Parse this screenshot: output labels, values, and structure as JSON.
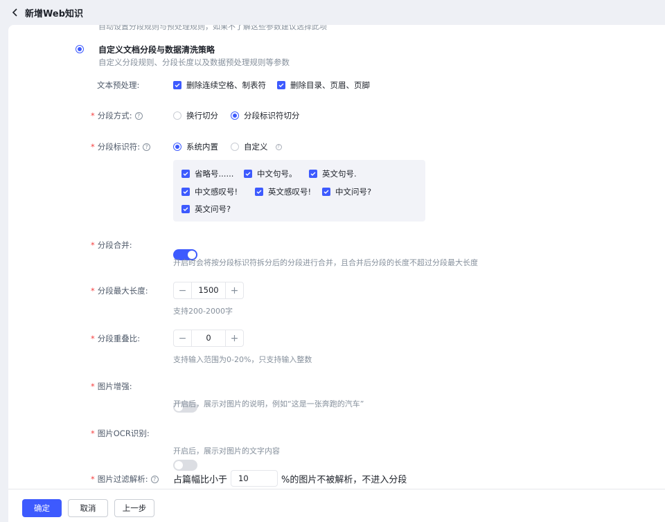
{
  "header": {
    "title": "新增Web知识"
  },
  "top_cut_text": "自动设置分段规则与预处理规则，如果不了解这些参数建议选择此项",
  "strategy": {
    "title": "自定义文档分段与数据清洗策略",
    "desc": "自定义分段规则、分段长度以及数据预处理规则等参数"
  },
  "preprocess": {
    "label": "文本预处理:",
    "options": [
      "删除连续空格、制表符",
      "删除目录、页眉、页脚"
    ]
  },
  "split_method": {
    "label": "分段方式:",
    "options": [
      "换行切分",
      "分段标识符切分"
    ],
    "selected": "分段标识符切分"
  },
  "delimiter": {
    "label": "分段标识符:",
    "options": [
      "系统内置",
      "自定义"
    ],
    "selected": "系统内置",
    "items": [
      "省略号......",
      "中文句号。",
      "英文句号.",
      "中文感叹号!",
      "英文感叹号!",
      "中文问号?",
      "英文问号?"
    ]
  },
  "merge": {
    "label": "分段合并:",
    "enabled": true,
    "hint": "开启时会将按分段标识符拆分后的分段进行合并，且合并后分段的长度不超过分段最大长度"
  },
  "max_length": {
    "label": "分段最大长度:",
    "value": "1500",
    "hint": "支持200-2000字"
  },
  "overlap": {
    "label": "分段重叠比:",
    "value": "0",
    "hint": "支持输入范围为0-20%，只支持输入整数"
  },
  "image_enhance": {
    "label": "图片增强:",
    "enabled": false,
    "hint": "开启后，展示对图片的说明，例如“这是一张奔跑的汽车”"
  },
  "image_ocr": {
    "label": "图片OCR识别:",
    "enabled": false,
    "hint": "开启后，展示对图片的文字内容"
  },
  "image_filter": {
    "label": "图片过滤解析:",
    "prefix": "占篇幅比小于",
    "value": "10",
    "suffix": "%的图片不被解析，不进入分段"
  },
  "footer": {
    "confirm": "确定",
    "cancel": "取消",
    "prev": "上一步"
  },
  "colors": {
    "accent": "#3d5afe",
    "required": "#f53f3f"
  }
}
